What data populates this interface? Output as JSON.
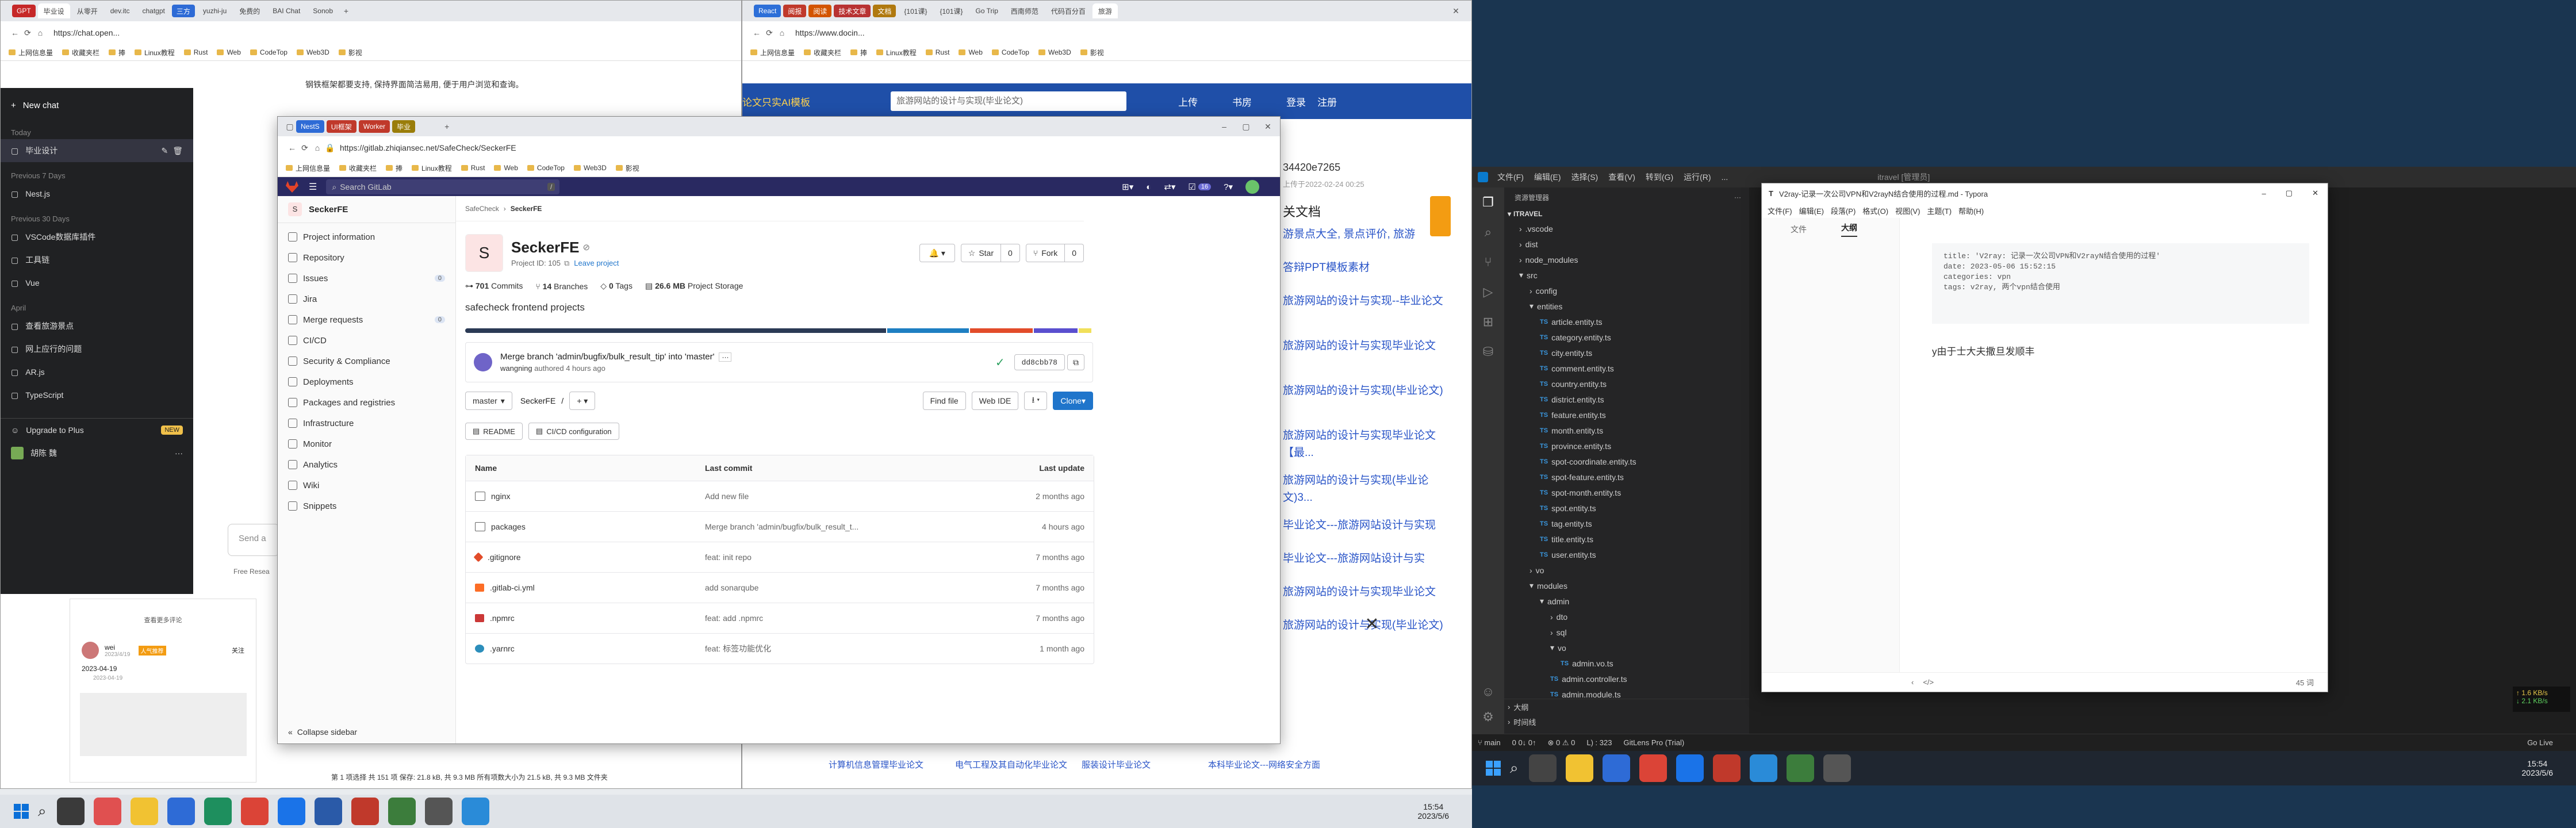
{
  "win1": {
    "tabs": [
      "GPT",
      "毕业设",
      "从零开",
      "dev.itc",
      "chatgpt",
      "三方",
      "yuzhi-ju",
      "免费的",
      "BAI Chat",
      "Sonob"
    ],
    "url": "https://chat.open...",
    "bookmarks": [
      "上网信息量",
      "收藏夹栏",
      "捧",
      "Linux教程",
      "Rust",
      "Web",
      "CodeTop",
      "Web3D",
      "影视"
    ],
    "top_text": "钢铁框架都要支持, 保持界面简洁易用, 便于用户浏览和查询。",
    "sidebar": {
      "new_chat": "New chat",
      "today": "Today",
      "today_items": [
        "毕业设计"
      ],
      "prev7": "Previous 7 Days",
      "prev7_items": [
        "Nest.js"
      ],
      "prev30": "Previous 30 Days",
      "prev30_items": [
        "VSCode数据库插件",
        "工具链",
        "Vue"
      ],
      "april": "April",
      "april_items": [
        "查看旅游景点",
        "网上应行的问题",
        "AR.js",
        "TypeScript"
      ],
      "upgrade": "Upgrade to Plus",
      "new_badge": "NEW",
      "user": "胡陈 魏"
    },
    "send_placeholder": "Send a",
    "free_text": "Free Resea",
    "card": {
      "more": "查看更多评论",
      "user": "wei",
      "date": "2023/4/19",
      "badge": "人气推荐",
      "follow": "关注",
      "date2": "2023-04-19",
      "date3": "2023-04-19"
    },
    "status": "第 1 项选择  共 151 项  保存: 21.8 kB, 共 9.3 MB  所有项数大小为 21.5 kB, 共 9.3 MB  文件夹"
  },
  "win2": {
    "tabs": [
      "React",
      "阅报",
      "阅读",
      "技术文章",
      "文档",
      "{101课}",
      "{101课}",
      "Go Trip",
      "西南师范",
      "代码百分百",
      "旅游"
    ],
    "url": "https://www.docin...",
    "bookmarks": [
      "上网信息量",
      "收藏夹栏",
      "捧",
      "Linux教程",
      "Rust",
      "Web",
      "CodeTop",
      "Web3D",
      "影视"
    ],
    "banner_left": "论文只实AI模板",
    "banner_search": "旅游网站的设计与实现(毕业论文)",
    "upload": "上传",
    "book": "书房",
    "login": "登录",
    "register": "注册",
    "doc_id": "34420e7265",
    "doc_date": "上传于2022-02-24 00:25",
    "section": "关文档",
    "links": [
      "游景点大全, 景点评价, 旅游",
      "答辩PPT模板素材",
      "旅游网站的设计与实现--毕业论文",
      "旅游网站的设计与实现毕业论文",
      "旅游网站的设计与实现(毕业论文)",
      "旅游网站的设计与实现毕业论文【最...",
      "旅游网站的设计与实现(毕业论文)3...",
      "毕业论文---旅游网站设计与实现",
      "毕业论文---旅游网站设计与实",
      "旅游网站的设计与实现毕业论文",
      "旅游网站的设计与实现(毕业论文)"
    ],
    "bottom_links": [
      "计算机信息管理毕业论文",
      "电气工程及其自动化毕业论文",
      "服装设计毕业论文",
      "本科毕业论文---网络安全方面"
    ]
  },
  "gitlab": {
    "tabs": [
      "NestS",
      "UI框架",
      "Worker",
      "毕业"
    ],
    "url": "https://gitlab.zhiqiansec.net/SafeCheck/SeckerFE",
    "bookmarks": [
      "上网信息量",
      "收藏夹栏",
      "捧",
      "Linux教程",
      "Rust",
      "Web",
      "CodeTop",
      "Web3D",
      "影视"
    ],
    "search": "Search GitLab",
    "search_key": "/",
    "notif_count": "16",
    "project_name": "SeckerFE",
    "project_initial": "S",
    "nav": [
      {
        "label": "Project information",
        "count": ""
      },
      {
        "label": "Repository",
        "count": ""
      },
      {
        "label": "Issues",
        "count": "0"
      },
      {
        "label": "Jira",
        "count": ""
      },
      {
        "label": "Merge requests",
        "count": "0"
      },
      {
        "label": "CI/CD",
        "count": ""
      },
      {
        "label": "Security & Compliance",
        "count": ""
      },
      {
        "label": "Deployments",
        "count": ""
      },
      {
        "label": "Packages and registries",
        "count": ""
      },
      {
        "label": "Infrastructure",
        "count": ""
      },
      {
        "label": "Monitor",
        "count": ""
      },
      {
        "label": "Analytics",
        "count": ""
      },
      {
        "label": "Wiki",
        "count": ""
      },
      {
        "label": "Snippets",
        "count": ""
      }
    ],
    "collapse": "Collapse sidebar",
    "breadcrumb": [
      "SafeCheck",
      "SeckerFE"
    ],
    "title": "SeckerFE",
    "project_id": "Project ID: 105",
    "leave": "Leave project",
    "star": "Star",
    "star_count": "0",
    "fork": "Fork",
    "fork_count": "0",
    "stats": [
      {
        "num": "701",
        "label": "Commits"
      },
      {
        "num": "14",
        "label": "Branches"
      },
      {
        "num": "0",
        "label": "Tags"
      },
      {
        "num": "26.6 MB",
        "label": "Project Storage"
      }
    ],
    "description": "safecheck frontend projects",
    "commit_msg": "Merge branch 'admin/bugfix/bulk_result_tip' into 'master'",
    "commit_author": "wangning",
    "commit_meta": "authored 4 hours ago",
    "sha": "dd8cbb78",
    "branch": "master",
    "path_name": "SeckerFE",
    "path_sep": "/",
    "find_file": "Find file",
    "web_ide": "Web IDE",
    "clone": "Clone",
    "readme": "README",
    "cicd_cfg": "CI/CD configuration",
    "cols": [
      "Name",
      "Last commit",
      "Last update"
    ],
    "rows": [
      {
        "name": "nginx",
        "commit": "Add new file",
        "date": "2 months ago",
        "icon": "folder"
      },
      {
        "name": "packages",
        "commit": "Merge branch 'admin/bugfix/bulk_result_t...",
        "date": "4 hours ago",
        "icon": "folder"
      },
      {
        "name": ".gitignore",
        "commit": "feat: init repo",
        "date": "7 months ago",
        "icon": "git"
      },
      {
        "name": ".gitlab-ci.yml",
        "commit": "add sonarqube",
        "date": "7 months ago",
        "icon": "gitlab"
      },
      {
        "name": ".npmrc",
        "commit": "feat: add .npmrc",
        "date": "7 months ago",
        "icon": "npm"
      },
      {
        "name": ".yarnrc",
        "commit": "feat: 标签功能优化",
        "date": "1 month ago",
        "icon": "yarn"
      }
    ]
  },
  "vscode": {
    "menu": [
      "文件(F)",
      "编辑(E)",
      "选择(S)",
      "查看(V)",
      "转到(G)",
      "运行(R)",
      "..."
    ],
    "title": "itravel [管理员]",
    "explorer": "资源管理器",
    "root": "ITRAVEL",
    "tree": [
      {
        "label": ".vscode",
        "type": "folder",
        "depth": 1
      },
      {
        "label": "dist",
        "type": "folder",
        "depth": 1
      },
      {
        "label": "node_modules",
        "type": "folder",
        "depth": 1
      },
      {
        "label": "src",
        "type": "folder-open",
        "depth": 1
      },
      {
        "label": "config",
        "type": "folder",
        "depth": 2
      },
      {
        "label": "entities",
        "type": "folder-open",
        "depth": 2
      },
      {
        "label": "article.entity.ts",
        "type": "ts",
        "depth": 3
      },
      {
        "label": "category.entity.ts",
        "type": "ts",
        "depth": 3
      },
      {
        "label": "city.entity.ts",
        "type": "ts",
        "depth": 3
      },
      {
        "label": "comment.entity.ts",
        "type": "ts",
        "depth": 3
      },
      {
        "label": "country.entity.ts",
        "type": "ts",
        "depth": 3
      },
      {
        "label": "district.entity.ts",
        "type": "ts",
        "depth": 3
      },
      {
        "label": "feature.entity.ts",
        "type": "ts",
        "depth": 3
      },
      {
        "label": "month.entity.ts",
        "type": "ts",
        "depth": 3
      },
      {
        "label": "province.entity.ts",
        "type": "ts",
        "depth": 3
      },
      {
        "label": "spot-coordinate.entity.ts",
        "type": "ts",
        "depth": 3
      },
      {
        "label": "spot-feature.entity.ts",
        "type": "ts",
        "depth": 3
      },
      {
        "label": "spot-month.entity.ts",
        "type": "ts",
        "depth": 3
      },
      {
        "label": "spot.entity.ts",
        "type": "ts",
        "depth": 3
      },
      {
        "label": "tag.entity.ts",
        "type": "ts",
        "depth": 3
      },
      {
        "label": "title.entity.ts",
        "type": "ts",
        "depth": 3
      },
      {
        "label": "user.entity.ts",
        "type": "ts",
        "depth": 3
      },
      {
        "label": "vo",
        "type": "folder",
        "depth": 2
      },
      {
        "label": "modules",
        "type": "folder-open",
        "depth": 2
      },
      {
        "label": "admin",
        "type": "folder-open",
        "depth": 3
      },
      {
        "label": "dto",
        "type": "folder",
        "depth": 4
      },
      {
        "label": "sql",
        "type": "folder",
        "depth": 4
      },
      {
        "label": "vo",
        "type": "folder-open",
        "depth": 4
      },
      {
        "label": "admin.vo.ts",
        "type": "ts",
        "depth": 5
      },
      {
        "label": "admin.controller.ts",
        "type": "ts",
        "depth": 4
      },
      {
        "label": "admin.module.ts",
        "type": "ts",
        "depth": 4
      }
    ],
    "outline": "大纲",
    "timeline": "时间线",
    "status": [
      "main",
      "0 0↓ 0↑",
      "⊗ 0 ⚠ 0",
      "L) : 323",
      "GitLens Pro (Trial)"
    ]
  },
  "typora": {
    "title": "V2ray-记录一次公司VPN和V2rayN结合使用的过程.md - Typora",
    "menu": [
      "文件(F)",
      "编辑(E)",
      "段落(P)",
      "格式(O)",
      "视图(V)",
      "主题(T)",
      "帮助(H)"
    ],
    "tab_files": "文件",
    "tab_outline": "大纲",
    "frontmatter": [
      "title: 'V2ray: 记录一次公司VPN和V2rayN结合使用的过程'",
      "date: 2023-05-06 15:52:15",
      "categories: vpn",
      "tags: v2ray, 两个vpn结合使用"
    ],
    "body": "y由于士大夫撒旦发顺丰",
    "word_count": "45 词"
  },
  "taskbar": {
    "time": "15:54",
    "date": "2023/5/6",
    "net_up": "↑ 1.6 KB/s",
    "net_down": "↓ 2.1 KB/s",
    "weather": "Go Live"
  }
}
